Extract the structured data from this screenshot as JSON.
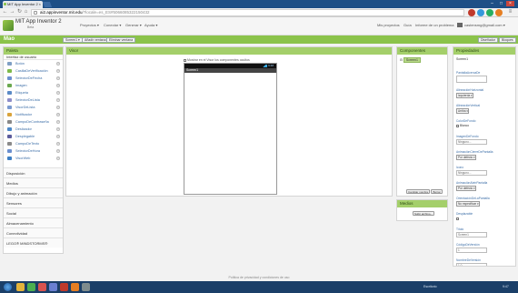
{
  "browser": {
    "tab_title": "MIT App Inventor 2",
    "tab_close": "×",
    "url_host": "ai2.appinventor.mit.edu",
    "url_path": "/?locale=es_ES#5066085322150432",
    "window_controls": [
      "–",
      "□",
      "×"
    ]
  },
  "app": {
    "title": "MIT App Inventor 2",
    "subtitle": "Beta",
    "menu": [
      "Proyectos ▾",
      "Conectar ▾",
      "Generar ▾",
      "Ayuda ▾"
    ],
    "right_menu": [
      "Mis proyectos",
      "Guía",
      "Informe de un problema"
    ],
    "user": "castensmg@gmail.com ▾"
  },
  "project_bar": {
    "name": "Mao",
    "buttons": [
      "Screen1 ▾",
      "Añadir ventana",
      "Eliminar ventana"
    ],
    "right_buttons": [
      "Diseñador",
      "Bloques"
    ]
  },
  "palette": {
    "title": "Paleta",
    "section": "Interfaz de usuario",
    "items": [
      {
        "label": "Botón",
        "color": "#7f9fc4"
      },
      {
        "label": "CasillaDeVerificación",
        "color": "#7db94a"
      },
      {
        "label": "SelectorDeFecha",
        "color": "#6b8fcf"
      },
      {
        "label": "Imagen",
        "color": "#6aa84f"
      },
      {
        "label": "Etiqueta",
        "color": "#5a8ac6"
      },
      {
        "label": "SelectorDeLista",
        "color": "#8e8ec9"
      },
      {
        "label": "VisorDeLista",
        "color": "#7a9ad0"
      },
      {
        "label": "Notificador",
        "color": "#d9a33b"
      },
      {
        "label": "CampoDeContraseña",
        "color": "#888888"
      },
      {
        "label": "Deslizador",
        "color": "#4c88c8"
      },
      {
        "label": "Desplegable",
        "color": "#5c5c9c"
      },
      {
        "label": "CampoDeTexto",
        "color": "#8a8a8a"
      },
      {
        "label": "SelectorDeHora",
        "color": "#6b8fcf"
      },
      {
        "label": "VisorWeb",
        "color": "#3d7fc4"
      }
    ],
    "help": "?",
    "categories": [
      "Disposición",
      "Medios",
      "Dibujo y animación",
      "Sensores",
      "Social",
      "Almacenamiento",
      "Conectividad",
      "LEGO® MINDSTORMS®"
    ]
  },
  "viewer": {
    "title": "Visor",
    "show_hidden": "Mostrar en el Visor los componentes ocultos",
    "clock": "9:48",
    "screen_title": "Screen1"
  },
  "components": {
    "title": "Componentes",
    "root": "Screen1",
    "rename": "Cambiar nombre",
    "delete": "Borrar"
  },
  "media": {
    "title": "Medios",
    "upload": "Subir archivo..."
  },
  "properties": {
    "title": "Propiedades",
    "component": "Screen1",
    "fields": [
      {
        "label": "PantallaAcercaDe",
        "kind": "textarea",
        "value": ""
      },
      {
        "label": "AlineaciónHorizontal",
        "kind": "select",
        "value": "Izquierda ▾"
      },
      {
        "label": "AlineaciónVertical",
        "kind": "select",
        "value": "Arriba ▾"
      },
      {
        "label": "ColorDeFondo",
        "kind": "check",
        "value": "Blanco"
      },
      {
        "label": "ImagenDeFondo",
        "kind": "text",
        "value": "Ninguno..."
      },
      {
        "label": "AnimaciónCierreDePantalla",
        "kind": "select",
        "value": "Por defecto ▾"
      },
      {
        "label": "Icono",
        "kind": "text",
        "value": "Ninguno..."
      },
      {
        "label": "AnimaciónAbrirPantalla",
        "kind": "select",
        "value": "Por defecto ▾"
      },
      {
        "label": "OrientaciónDeLaPantalla",
        "kind": "select",
        "value": "No especificar ▾"
      },
      {
        "label": "Desplazable",
        "kind": "check",
        "value": ""
      },
      {
        "label": "Título",
        "kind": "text",
        "value": "Screen1"
      },
      {
        "label": "CódigoDeVersión",
        "kind": "text",
        "value": "1"
      },
      {
        "label": "NombreDeVersión",
        "kind": "text",
        "value": "1.0"
      }
    ]
  },
  "footer": "Política de privacidad y condiciones de uso",
  "taskbar": {
    "tray_text": "Escritorio",
    "time": "9:47",
    "apps": [
      {
        "name": "explorer-app",
        "color": "#e3b33b"
      },
      {
        "name": "chrome-app",
        "color": "#4caf50"
      },
      {
        "name": "media-app",
        "color": "#d9534f"
      },
      {
        "name": "paint-app",
        "color": "#6a7fd0"
      },
      {
        "name": "office-app",
        "color": "#c0392b"
      },
      {
        "name": "firefox-app",
        "color": "#e67e22"
      },
      {
        "name": "misc-app",
        "color": "#7f8c8d"
      }
    ]
  }
}
